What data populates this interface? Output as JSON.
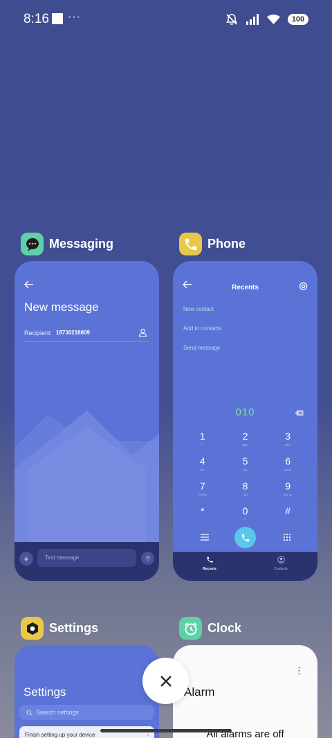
{
  "status_bar": {
    "time": "8:16",
    "overflow": "···",
    "battery": "100",
    "icons": [
      "square-notification-icon",
      "mute-icon",
      "signal-icon",
      "wifi-icon",
      "battery-icon"
    ]
  },
  "recents": [
    {
      "app": "Messaging",
      "icon": "messaging-bubble-icon",
      "color": "#5fd0a7",
      "screen": {
        "title": "New message",
        "recipient_label": "Recipient:",
        "recipient_value": "18730218809",
        "input_placeholder": "Text message"
      }
    },
    {
      "app": "Phone",
      "icon": "phone-handset-icon",
      "color": "#e8c84a",
      "screen": {
        "title": "Recents",
        "options": [
          "New contact",
          "Add to contacts",
          "Send message"
        ],
        "dialed_number": "010",
        "keypad": [
          {
            "digit": "1",
            "letters": "",
            "sub": "voicemail-icon"
          },
          {
            "digit": "2",
            "letters": "ABC"
          },
          {
            "digit": "3",
            "letters": "DEF"
          },
          {
            "digit": "4",
            "letters": "GHI"
          },
          {
            "digit": "5",
            "letters": "JKL"
          },
          {
            "digit": "6",
            "letters": "MNO"
          },
          {
            "digit": "7",
            "letters": "PQRS"
          },
          {
            "digit": "8",
            "letters": "TUV"
          },
          {
            "digit": "9",
            "letters": "WXYZ"
          },
          {
            "digit": "*",
            "letters": ","
          },
          {
            "digit": "0",
            "letters": "+"
          },
          {
            "digit": "#",
            "letters": ";"
          }
        ],
        "nav": [
          "Recents",
          "Contacts"
        ]
      }
    },
    {
      "app": "Settings",
      "icon": "settings-gear-icon",
      "color": "#e8c84a",
      "screen": {
        "title": "Settings",
        "search_placeholder": "Search settings",
        "banner": "Finish setting up your device"
      }
    },
    {
      "app": "Clock",
      "icon": "alarm-clock-icon",
      "color": "#5fd0a7",
      "screen": {
        "title": "Alarm",
        "empty": "All alarms are off"
      }
    }
  ],
  "close_all_icon": "close-icon"
}
